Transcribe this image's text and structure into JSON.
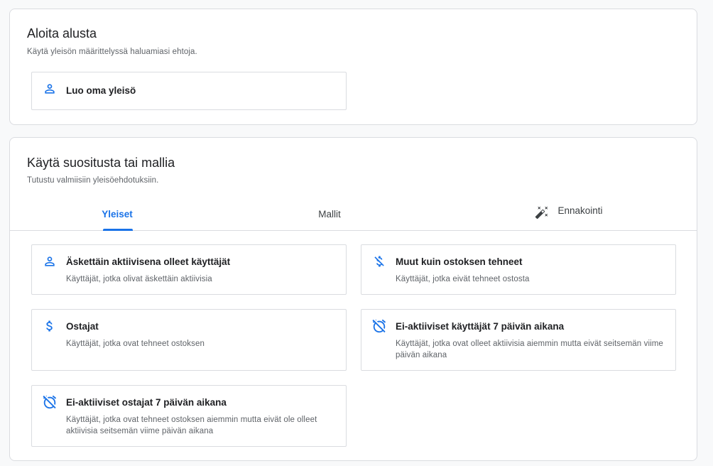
{
  "start_panel": {
    "title": "Aloita alusta",
    "subtitle": "Käytä yleisön määrittelyssä haluamiasi ehtoja.",
    "create_card": {
      "label": "Luo oma yleisö",
      "icon": "person-icon"
    }
  },
  "suggest_panel": {
    "title": "Käytä suositusta tai mallia",
    "subtitle": "Tutustu valmiisiin yleisöehdotuksiin.",
    "tabs": [
      {
        "label": "Yleiset",
        "active": true
      },
      {
        "label": "Mallit",
        "active": false
      },
      {
        "label": "Ennakointi",
        "active": false,
        "icon": "magic-wand-icon"
      }
    ],
    "cards": [
      {
        "title": "Äskettäin aktiivisena olleet käyttäjät",
        "desc": "Käyttäjät, jotka olivat äskettäin aktiivisia",
        "icon": "person-icon"
      },
      {
        "title": "Muut kuin ostoksen tehneet",
        "desc": "Käyttäjät, jotka eivät tehneet ostosta",
        "icon": "money-off-icon"
      },
      {
        "title": "Ostajat",
        "desc": "Käyttäjät, jotka ovat tehneet ostoksen",
        "icon": "dollar-icon"
      },
      {
        "title": "Ei-aktiiviset käyttäjät 7 päivän aikana",
        "desc": "Käyttäjät, jotka ovat olleet aktiivisia aiemmin mutta eivät seitsemän viime päivän aikana",
        "icon": "alarm-off-icon"
      },
      {
        "title": "Ei-aktiiviset ostajat 7 päivän aikana",
        "desc": "Käyttäjät, jotka ovat tehneet ostoksen aiemmin mutta eivät ole olleet aktiivisia seitsemän viime päivän aikana",
        "icon": "alarm-off-icon"
      }
    ]
  },
  "colors": {
    "accent": "#1a73e8",
    "border": "#dadce0",
    "text": "#202124",
    "muted": "#5f6368"
  }
}
